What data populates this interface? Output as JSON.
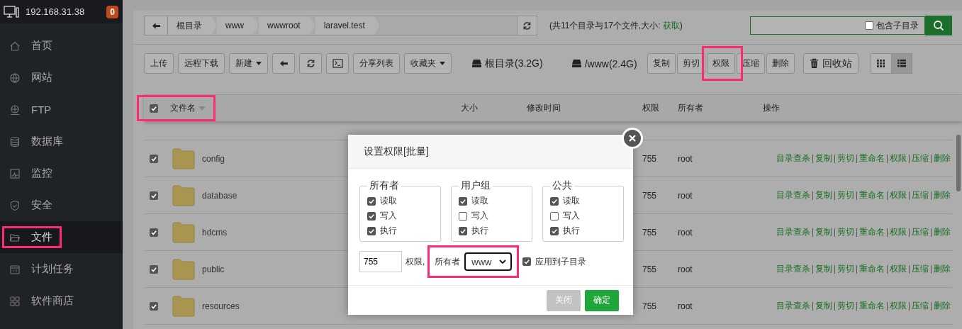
{
  "sidebar": {
    "host": "192.168.31.38",
    "badge": "0",
    "items": [
      {
        "label": "首页",
        "selected": false,
        "highlighted": false
      },
      {
        "label": "网站",
        "selected": false,
        "highlighted": false
      },
      {
        "label": "FTP",
        "selected": false,
        "highlighted": false
      },
      {
        "label": "数据库",
        "selected": false,
        "highlighted": false
      },
      {
        "label": "监控",
        "selected": false,
        "highlighted": false
      },
      {
        "label": "安全",
        "selected": false,
        "highlighted": false
      },
      {
        "label": "文件",
        "selected": true,
        "highlighted": true
      },
      {
        "label": "计划任务",
        "selected": false,
        "highlighted": false
      },
      {
        "label": "软件商店",
        "selected": false,
        "highlighted": false
      }
    ]
  },
  "breadcrumb": {
    "segments": [
      "根目录",
      "www",
      "wwwroot",
      "laravel.test"
    ]
  },
  "summary": {
    "before": "(共11个目录与17个文件,大小: ",
    "link": "获取",
    "after": ")"
  },
  "search": {
    "include_subdirs": {
      "label": "包含子目录",
      "checked": false
    }
  },
  "toolbar": {
    "buttons": [
      {
        "kind": "text",
        "label": "上传"
      },
      {
        "kind": "text",
        "label": "远程下载"
      },
      {
        "kind": "dropdown",
        "label": "新建"
      },
      {
        "kind": "back"
      },
      {
        "kind": "refresh"
      },
      {
        "kind": "terminal"
      },
      {
        "kind": "text",
        "label": "分享列表"
      },
      {
        "kind": "dropdown",
        "label": "收藏夹"
      }
    ],
    "disks": [
      {
        "label": "根目录(3.2G)"
      },
      {
        "label": "/www(2.4G)"
      }
    ],
    "actions": [
      {
        "label": "复制",
        "highlighted": false
      },
      {
        "label": "剪切",
        "highlighted": false
      },
      {
        "label": "权限",
        "highlighted": true
      },
      {
        "label": "压缩",
        "highlighted": false
      },
      {
        "label": "删除",
        "highlighted": false
      }
    ],
    "recycle": {
      "label": "回收站"
    },
    "views": [
      {
        "kind": "grid",
        "selected": false
      },
      {
        "kind": "list",
        "selected": true
      }
    ]
  },
  "table": {
    "checked": true,
    "name_highlighted": true,
    "columns": [
      "文件名",
      "大小",
      "修改时间",
      "权限",
      "所有者",
      "操作"
    ],
    "rows": [
      {
        "name": "config",
        "checked": true,
        "permission": "755",
        "owner": "root",
        "actions": [
          "目录查杀",
          "复制",
          "剪切",
          "重命名",
          "权限",
          "压缩",
          "删除"
        ]
      },
      {
        "name": "database",
        "checked": true,
        "permission": "755",
        "owner": "root",
        "actions": [
          "目录查杀",
          "复制",
          "剪切",
          "重命名",
          "权限",
          "压缩",
          "删除"
        ]
      },
      {
        "name": "hdcms",
        "checked": true,
        "permission": "755",
        "owner": "root",
        "actions": [
          "目录查杀",
          "复制",
          "剪切",
          "重命名",
          "权限",
          "压缩",
          "删除"
        ]
      },
      {
        "name": "public",
        "checked": true,
        "permission": "755",
        "owner": "root",
        "actions": [
          "目录查杀",
          "复制",
          "剪切",
          "重命名",
          "权限",
          "压缩",
          "删除"
        ]
      },
      {
        "name": "resources",
        "checked": true,
        "permission": "755",
        "owner": "root",
        "actions": [
          "目录查杀",
          "复制",
          "剪切",
          "重命名",
          "权限",
          "压缩",
          "删除"
        ]
      }
    ]
  },
  "modal": {
    "title": "设置权限[批量]",
    "groups": [
      {
        "legend": "所有者",
        "options": [
          {
            "label": "读取",
            "checked": true
          },
          {
            "label": "写入",
            "checked": true
          },
          {
            "label": "执行",
            "checked": true
          }
        ]
      },
      {
        "legend": "用户组",
        "options": [
          {
            "label": "读取",
            "checked": true
          },
          {
            "label": "写入",
            "checked": false
          },
          {
            "label": "执行",
            "checked": true
          }
        ]
      },
      {
        "legend": "公共",
        "options": [
          {
            "label": "读取",
            "checked": true
          },
          {
            "label": "写入",
            "checked": false
          },
          {
            "label": "执行",
            "checked": true
          }
        ]
      }
    ],
    "mode": "755",
    "mode_suffix": "权限,",
    "owner_label": "所有者",
    "owner_value": "www",
    "owner_highlighted": true,
    "apply_sub": {
      "label": "应用到子目录",
      "checked": true
    },
    "buttons": [
      {
        "kind": "cancel",
        "label": "关闭"
      },
      {
        "kind": "confirm",
        "label": "确定"
      }
    ]
  }
}
